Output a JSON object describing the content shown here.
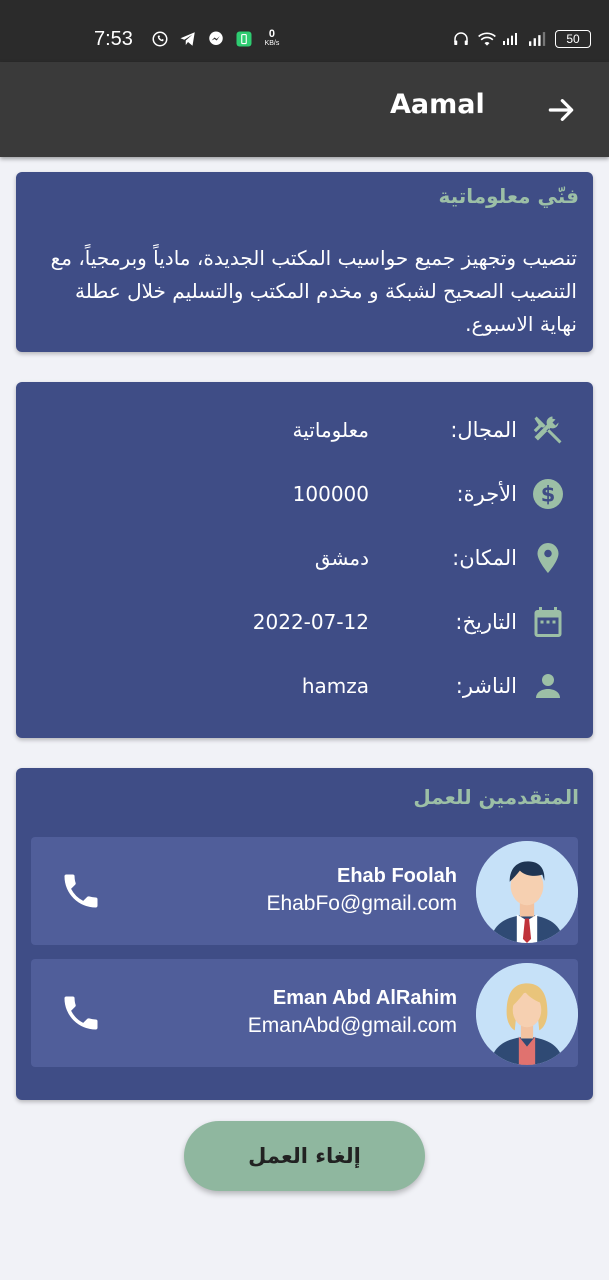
{
  "status_bar": {
    "time": "7:53",
    "net_speed_value": "0",
    "net_speed_unit": "KB/s",
    "battery": "50"
  },
  "app_bar": {
    "title": "Aamal"
  },
  "job": {
    "title": "فنّي معلوماتية",
    "description": "تنصيب وتجهيز جميع حواسيب المكتب الجديدة، مادياً وبرمجياً، مع التنصيب الصحيح لشبكة و مخدم المكتب والتسليم خلال عطلة نهاية الاسبوع."
  },
  "details": [
    {
      "icon": "tools-icon",
      "label": "المجال:",
      "value": "معلوماتية"
    },
    {
      "icon": "dollar-icon",
      "label": "الأجرة:",
      "value": "100000"
    },
    {
      "icon": "location-pin-icon",
      "label": "المكان:",
      "value": "دمشق"
    },
    {
      "icon": "calendar-icon",
      "label": "التاريخ:",
      "value": "2022-07-12"
    },
    {
      "icon": "person-icon",
      "label": "الناشر:",
      "value": "hamza"
    }
  ],
  "applicants": {
    "title": "المتقدمين للعمل",
    "items": [
      {
        "name": "Ehab Foolah",
        "email": "EhabFo@gmail.com",
        "avatar": "male-avatar"
      },
      {
        "name": "Eman Abd AlRahim",
        "email": "EmanAbd@gmail.com",
        "avatar": "female-avatar"
      }
    ]
  },
  "cancel_button": {
    "label": "إلغاء العمل"
  },
  "colors": {
    "card": "#3f4d86",
    "applicant_row": "#505e9a",
    "accent": "#9cbfa6",
    "button": "#8fb79f"
  }
}
